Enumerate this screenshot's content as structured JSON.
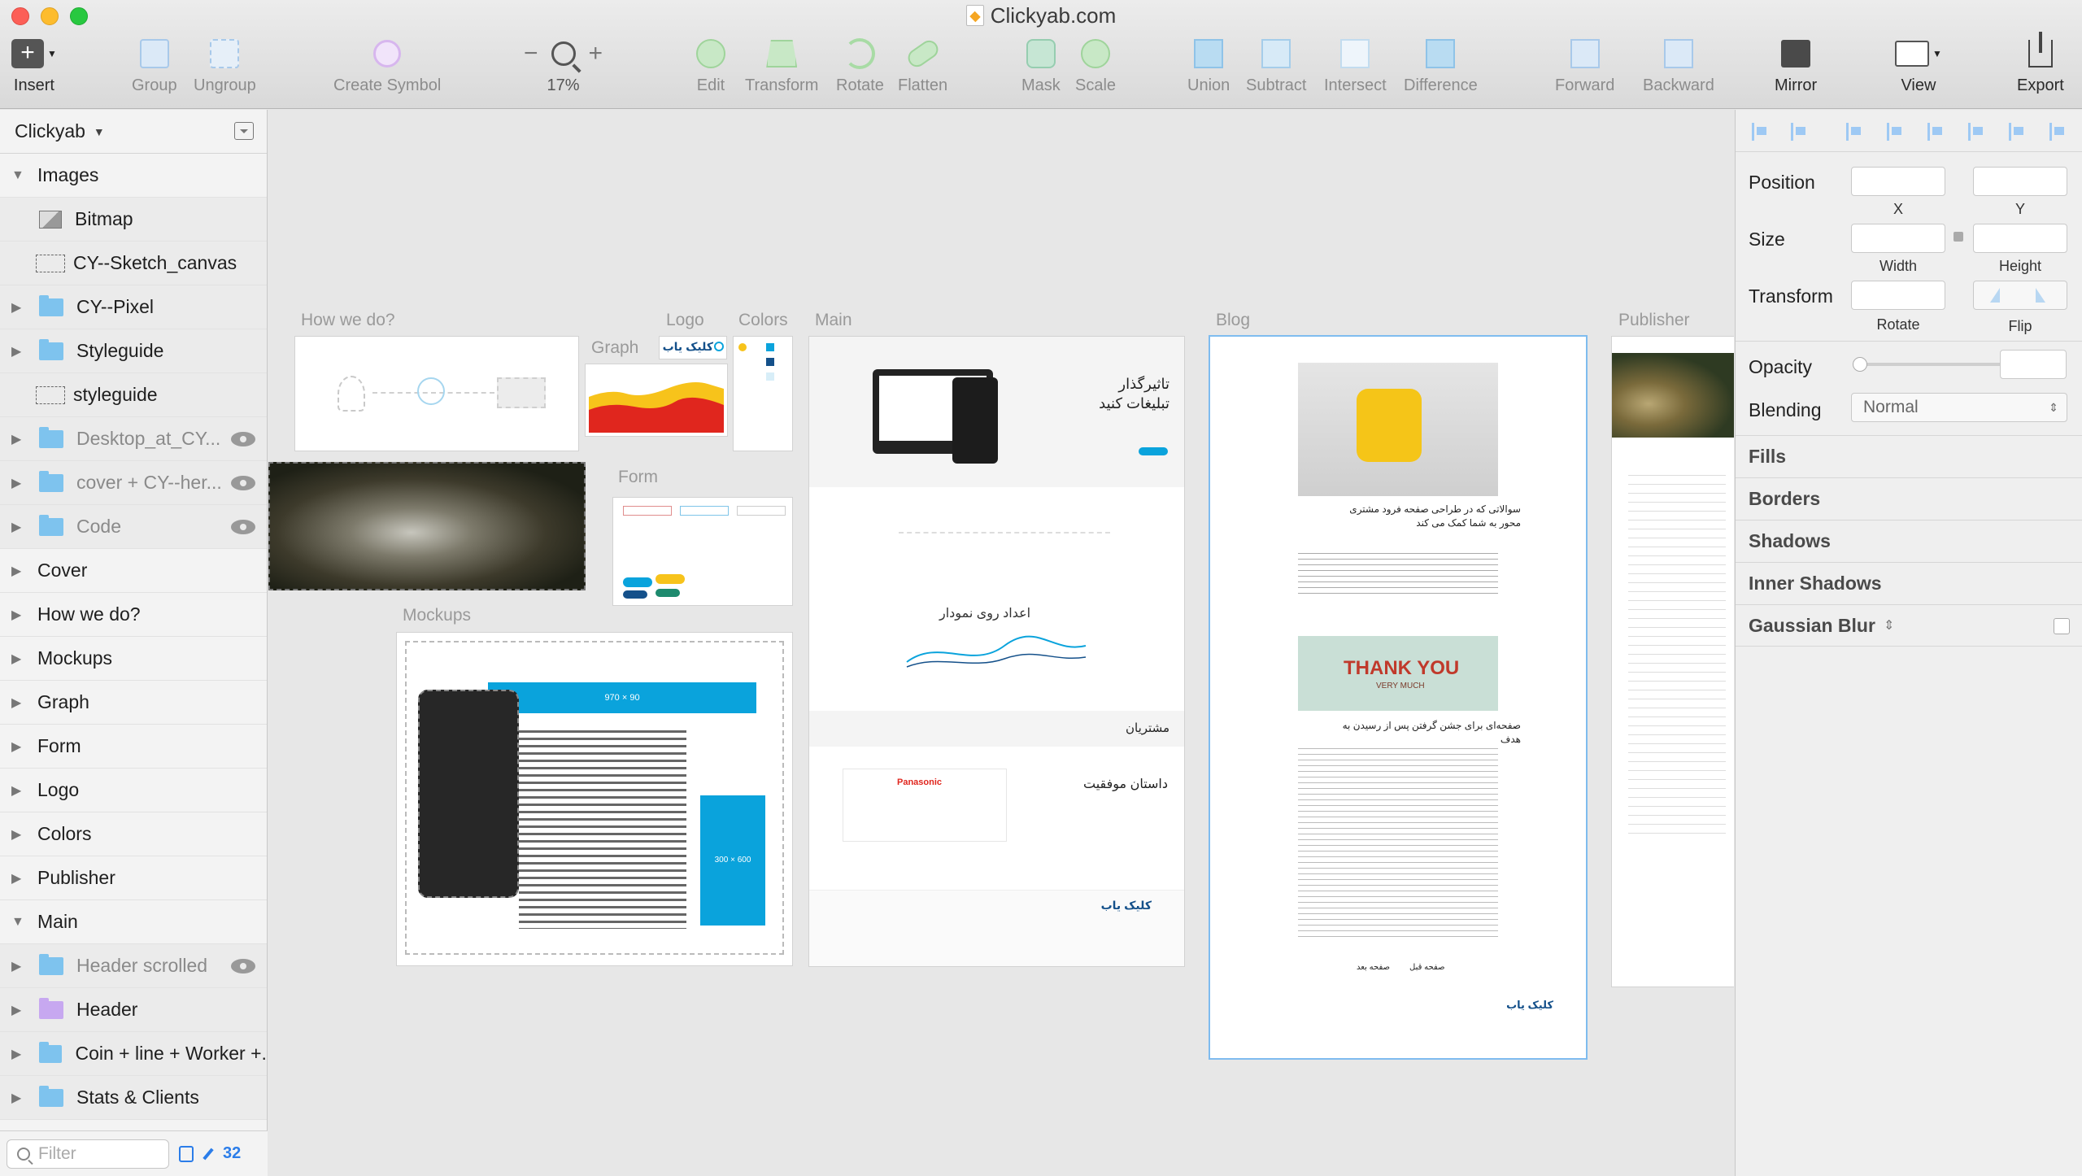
{
  "window": {
    "title": "Clickyab.com"
  },
  "toolbar": {
    "insert": "Insert",
    "group": "Group",
    "ungroup": "Ungroup",
    "create_symbol": "Create Symbol",
    "zoom_minus": "−",
    "zoom_plus": "+",
    "zoom_level": "17%",
    "edit": "Edit",
    "transform": "Transform",
    "rotate": "Rotate",
    "flatten": "Flatten",
    "mask": "Mask",
    "scale": "Scale",
    "union": "Union",
    "subtract": "Subtract",
    "intersect": "Intersect",
    "difference": "Difference",
    "forward": "Forward",
    "backward": "Backward",
    "mirror": "Mirror",
    "view": "View",
    "export": "Export"
  },
  "sidebar": {
    "page_name": "Clickyab",
    "layers": [
      {
        "name": "Images",
        "icon": "triangle-open"
      },
      {
        "name": "Bitmap",
        "icon": "bitmap-icon"
      },
      {
        "name": "CY--Sketch_canvas",
        "icon": "slice-icon"
      },
      {
        "name": "CY--Pixel",
        "icon": "folder-icon"
      },
      {
        "name": "Styleguide",
        "icon": "folder-icon"
      },
      {
        "name": "styleguide",
        "icon": "slice-icon"
      },
      {
        "name": "Desktop_at_CY...",
        "icon": "folder-icon"
      },
      {
        "name": "cover + CY--her...",
        "icon": "folder-icon"
      },
      {
        "name": "Code",
        "icon": "folder-icon"
      },
      {
        "name": "Cover",
        "icon": "triangle-closed"
      },
      {
        "name": "How we do?",
        "icon": "triangle-closed"
      },
      {
        "name": "Mockups",
        "icon": "triangle-closed"
      },
      {
        "name": "Graph",
        "icon": "triangle-closed"
      },
      {
        "name": "Form",
        "icon": "triangle-closed"
      },
      {
        "name": "Logo",
        "icon": "triangle-closed"
      },
      {
        "name": "Colors",
        "icon": "triangle-closed"
      },
      {
        "name": "Publisher",
        "icon": "triangle-closed"
      },
      {
        "name": "Main",
        "icon": "triangle-open"
      },
      {
        "name": "Header scrolled",
        "icon": "folder-icon"
      },
      {
        "name": "Header",
        "icon": "folder-icon"
      },
      {
        "name": "Coin + line + Worker +...",
        "icon": "folder-icon"
      },
      {
        "name": "Stats & Clients",
        "icon": "folder-icon"
      }
    ],
    "filter_placeholder": "Filter",
    "count": "32"
  },
  "canvas": {
    "labels": {
      "how_we_do": "How we do?",
      "logo": "Logo",
      "colors": "Colors",
      "graph": "Graph",
      "form": "Form",
      "mockups": "Mockups",
      "main": "Main",
      "blog": "Blog",
      "publisher": "Publisher"
    },
    "logo_text": "کلیک یاب",
    "mockup_banner": "970 × 90",
    "mockup_side": "300 × 600",
    "main_hero_title_1": "تاثیرگذار",
    "main_hero_title_2": "تبلیغات کنید",
    "main_chart_title": "اعداد روی نمودار",
    "main_clients": "مشتریان",
    "main_story": "داستان موفقیت",
    "main_story_brand": "Panasonic",
    "blog_post1_title": "سوالاتی که در طراحی صفحه فرود مشتری محور به شما کمک می کند",
    "blog_post2_title": "صفحه‌ای برای جشن گرفتن پس از رسیدن به هدف",
    "blog_thankyou": "THANK YOU",
    "blog_thankyou_sub": "VERY MUCH",
    "blog_next": "صفحه بعد",
    "blog_prev": "صفحه قبل"
  },
  "inspector": {
    "position_label": "Position",
    "x_label": "X",
    "y_label": "Y",
    "size_label": "Size",
    "width_label": "Width",
    "height_label": "Height",
    "transform_label": "Transform",
    "rotate_label": "Rotate",
    "flip_label": "Flip",
    "opacity_label": "Opacity",
    "blending_label": "Blending",
    "blending_value": "Normal",
    "fills": "Fills",
    "borders": "Borders",
    "shadows": "Shadows",
    "inner_shadows": "Inner Shadows",
    "gaussian_blur": "Gaussian Blur"
  },
  "colors": {
    "accent": "#2b7de9",
    "brand_blue": "#0aa3dc",
    "graph_yellow": "#f7c31b",
    "graph_red": "#e0261e"
  }
}
